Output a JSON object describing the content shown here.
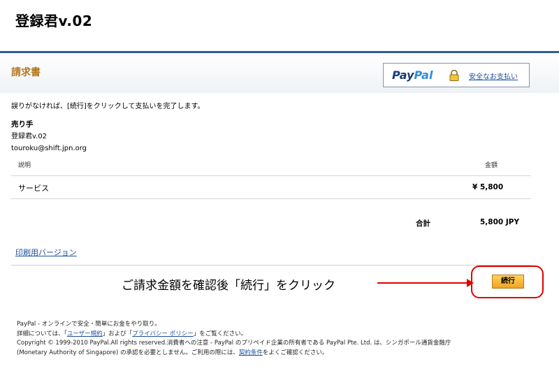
{
  "site": {
    "title": "登録君v.02"
  },
  "header": {
    "invoice_title": "請求書",
    "paypal_logo_part1": "Pay",
    "paypal_logo_part2": "Pal",
    "secure_payment_link": "安全なお支払い",
    "lock_icon": "lock-icon"
  },
  "instruction": "誤りがなければ、[続行]をクリックして支払いを完了します。",
  "seller": {
    "label": "売り手",
    "name": "登録君v.02",
    "email": "touroku@shift.jpn.org"
  },
  "table": {
    "headers": {
      "description": "説明",
      "amount": "金額"
    },
    "rows": [
      {
        "description": "サービス",
        "amount": "¥ 5,800"
      }
    ],
    "total_label": "合計",
    "total_value": "5,800 JPY"
  },
  "print_version_link": "印刷用バージョン",
  "annotation": "ご請求金額を確認後「続行」をクリック",
  "continue_button": "続行",
  "colors": {
    "accent_title": "#b5771e",
    "topbar": "#2f5d93",
    "annotation_red": "#e00000",
    "button": "#f1a323"
  },
  "footer": {
    "line1": "PayPal - オンラインで安全・簡単にお金をやり取り。",
    "line2_a": "詳細については、「",
    "link_user_agreement": "ユーザー規約",
    "line2_b": "」および「",
    "link_privacy": "プライバシー ポリシー",
    "line2_c": "」をご覧ください。",
    "line3": "Copyright © 1999-2010 PayPal.All rights reserved.消費者への注意 - PayPal のプリペイド企業の所有者である PayPal Pte. Ltd. は、シンガポール通貨金融庁",
    "line4_a": "(Monetary Authority of Singapore) の承認を必要としません。ご利用の際には、",
    "link_terms": "契約条件",
    "line4_b": "をよくご確認ください。"
  }
}
